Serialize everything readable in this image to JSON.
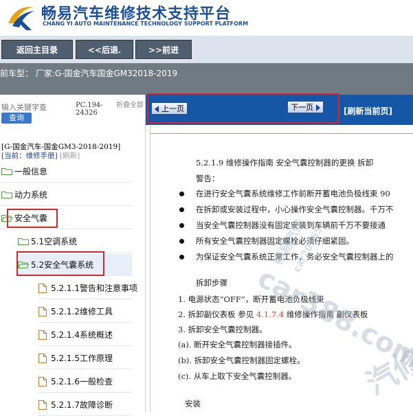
{
  "header": {
    "title": "畅易汽车维修技术支持平台",
    "subtitle": "CHANG YI AUTO MAINTENANCE TECHNOLOGY SUPPORT PLATFORM"
  },
  "nav": {
    "home": "返回主目录",
    "back": "<<后退.",
    "forward": ">>前进"
  },
  "model": {
    "text": "前车型：  厂家:G-国金汽车国金GM32018-2019"
  },
  "sidebar": {
    "search_placeholder": "输入关键字查",
    "search_button": "查询",
    "pc_number": "PC.194-24326",
    "collapse_label": "折叠全部",
    "book_title": "[G-国金汽车-国金GM3-2018-2019]",
    "current_label": "[当前：维修手册]",
    "refresh_label": "[刷新]",
    "items": [
      {
        "label": "一般信息"
      },
      {
        "label": "动力系统"
      },
      {
        "label": "安全气囊"
      },
      {
        "label": "5.1空调系统"
      },
      {
        "label": "5.2安全气囊系统"
      },
      {
        "label": "5.2.1.1警告和注意事项"
      },
      {
        "label": "5.2.1.2维修工具"
      },
      {
        "label": "5.2.1.4系统概述"
      },
      {
        "label": "5.2.1.5工作原理"
      },
      {
        "label": "5.2.1.6一般检查"
      },
      {
        "label": "5.2.1.7故障诊断"
      }
    ]
  },
  "pager": {
    "prev": "上一页",
    "next": "下一页",
    "refresh_home": "[刷新当前页]"
  },
  "doc": {
    "heading": "5.2.1.9 维修操作指南 安全气囊控制器的更换 拆卸",
    "warning_title": "警告：",
    "bullets": [
      "在进行安全气囊系统维修工作前断开蓄电池负极线束 90",
      "在拆卸或安装过程中，小心操作安全气囊控制器。千万不",
      "当安全气囊控制器没有固定安装到车辆前千万不要接通",
      "所有安全气囊控制器固定螺栓必须仔细紧固。",
      "为保证安全气囊系统正常工作，务必安全气囊控制器上的"
    ],
    "steps_title": "拆卸步骤",
    "step1": "1.  电源状态“OFF”，断开蓄电池负极线束",
    "step2_prefix": "2.  拆卸副仪表板    参见 ",
    "step2_link": "4.1.7.4",
    "step2_suffix": " 维修操作指南    副仪表板",
    "step3": "3.  拆卸安全气囊控制器。",
    "step_a": "(a).  断开安全气囊控制器接插件。",
    "step_b": "(b).  拆卸安全气囊控制器固定螺栓。",
    "step_c": "(c).  从车上取下安全气囊控制器。",
    "install_title": "安装"
  },
  "watermark": {
    "main": "car388.com",
    "sub": "畅易汽修",
    "sub2": "car20165",
    "sub3": "汽修"
  },
  "colors": {
    "brand": "#1b4f9c",
    "nav_button": "#4f5f70",
    "model_bar": "#707a82",
    "pager_bar": "#1557a6",
    "highlight": "#d8232a",
    "folder": "#4a9a3a"
  }
}
